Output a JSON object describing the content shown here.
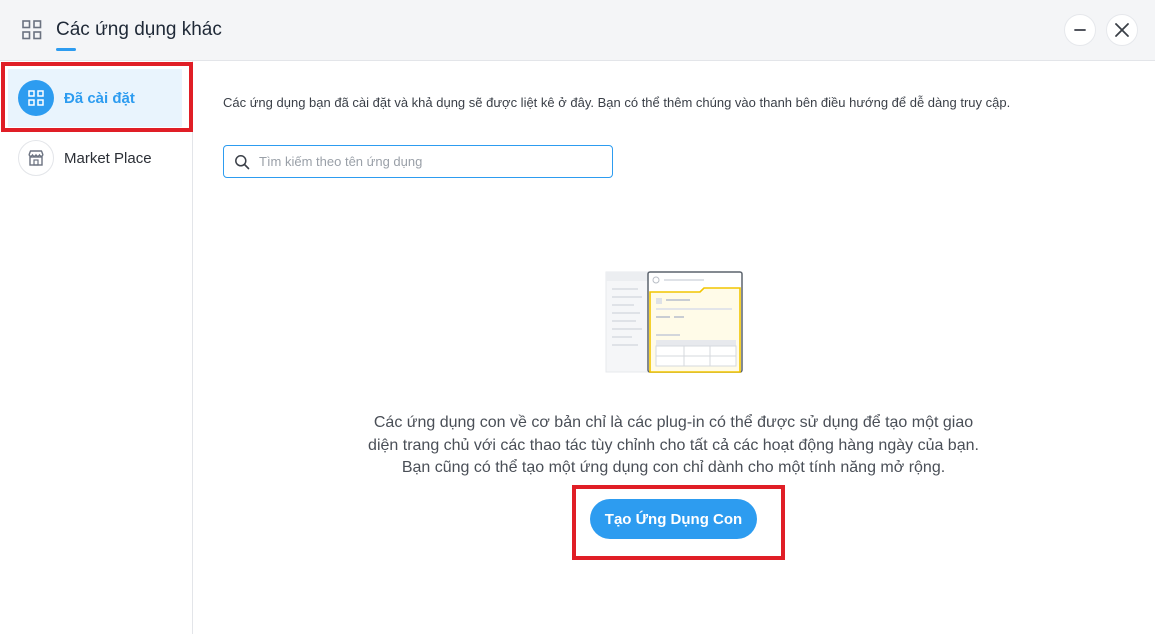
{
  "header": {
    "title": "Các ứng dụng khác",
    "minimize_icon": "minus-icon",
    "close_icon": "close-icon"
  },
  "sidebar": {
    "items": [
      {
        "label": "Đã cài đặt",
        "icon": "grid-icon",
        "active": true
      },
      {
        "label": "Market Place",
        "icon": "store-icon",
        "active": false
      }
    ]
  },
  "main": {
    "description": "Các ứng dụng bạn đã cài đặt và khả dụng sẽ được liệt kê ở đây. Bạn có thể thêm chúng vào thanh bên điều hướng để dễ dàng truy cập.",
    "search": {
      "placeholder": "Tìm kiếm theo tên ứng dụng",
      "value": ""
    },
    "empty_state": {
      "line1": "Các ứng dụng con về cơ bản chỉ là các plug-in có thể được sử dụng để tạo một giao",
      "line2": "diện trang chủ với các thao tác tùy chỉnh cho tất cả các hoạt động hàng ngày của bạn.",
      "line3": "Bạn cũng có thể tạo một ứng dụng con chỉ dành cho một tính năng mở rộng."
    },
    "create_button_label": "Tạo Ứng Dụng Con"
  },
  "colors": {
    "accent": "#2d9cf0",
    "highlight": "#e01e26",
    "header_bg": "#f4f5f7"
  }
}
